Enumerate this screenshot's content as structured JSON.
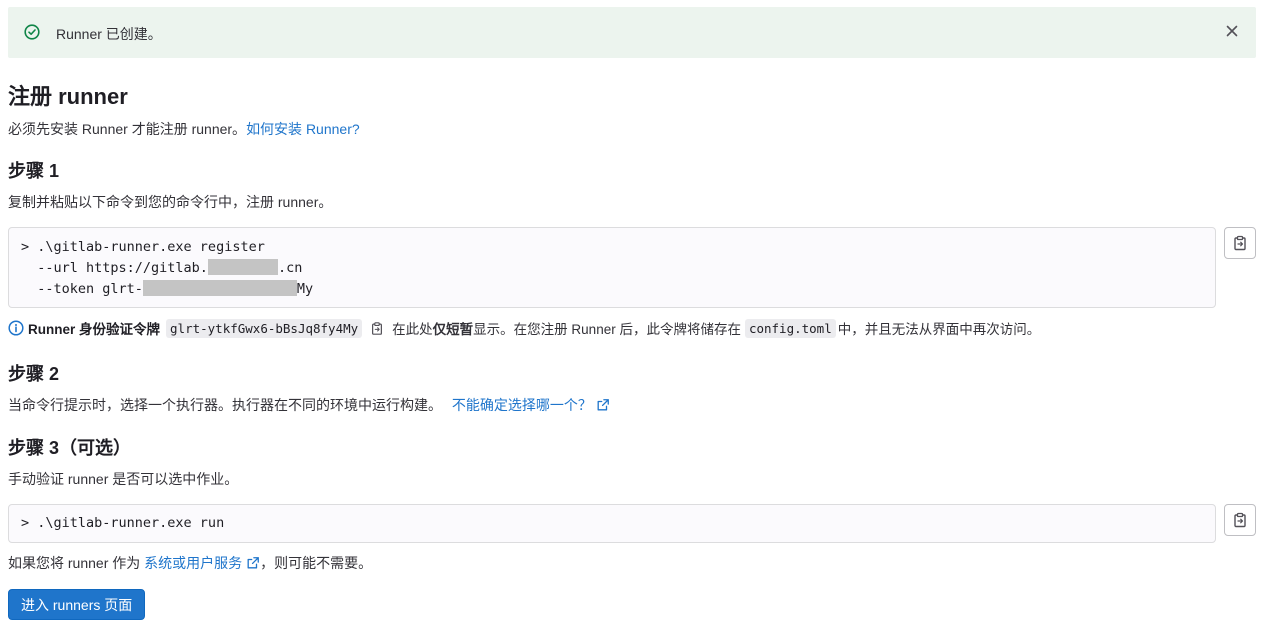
{
  "alert": {
    "message": "Runner 已创建。"
  },
  "title": "注册 runner",
  "intro": {
    "text": "必须先安装 Runner 才能注册 runner。",
    "link": "如何安装 Runner?"
  },
  "step1": {
    "heading": "步骤 1",
    "desc": "复制并粘贴以下命令到您的命令行中，注册 runner。",
    "cmd_line1": "> .\\gitlab-runner.exe register",
    "cmd_line2_prefix": "  --url https://gitlab.",
    "cmd_line2_suffix": ".cn",
    "cmd_line3_prefix": "  --token glrt-",
    "cmd_line3_suffix": "My"
  },
  "token": {
    "label": "Runner 身份验证令牌",
    "value": "glrt-ytkfGwx6-bBsJq8fy4My",
    "note_before": "在此处",
    "note_bold": "仅短暂",
    "note_after": "显示。在您注册 Runner 后，此令牌将储存在",
    "file": "config.toml",
    "note_end": "中，并且无法从界面中再次访问。"
  },
  "step2": {
    "heading": "步骤 2",
    "desc": "当命令行提示时，选择一个执行器。执行器在不同的环境中运行构建。",
    "link": "不能确定选择哪一个？"
  },
  "step3": {
    "heading": "步骤 3（可选）",
    "desc": "手动验证 runner 是否可以选中作业。",
    "cmd": "> .\\gitlab-runner.exe run"
  },
  "service": {
    "before": "如果您将 runner 作为",
    "link": "系统或用户服务",
    "after": "，则可能不需要。"
  },
  "go_button": "进入 runners 页面",
  "colors": {
    "link": "#1f75cb",
    "success": "#108548",
    "alert_bg": "#ecf4ee",
    "primary": "#1f75cb"
  }
}
